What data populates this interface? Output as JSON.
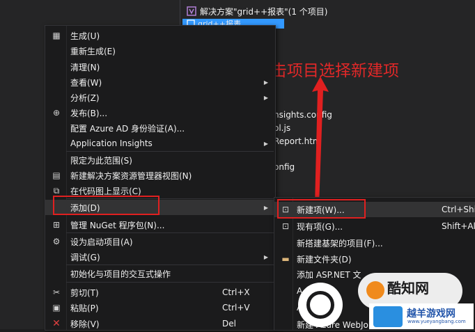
{
  "solution_explorer": {
    "solution_label": "解决方案\"grid++报表\"(1 个项目)",
    "project_label": "grid++报表",
    "files": [
      "nsights.config",
      "ol.js",
      "Report.htm",
      "onfig"
    ]
  },
  "annotation": "右键单击项目选择新建项",
  "context_menu": {
    "build": "生成(U)",
    "rebuild": "重新生成(E)",
    "clean": "清理(N)",
    "view": "查看(W)",
    "analyze": "分析(Z)",
    "publish": "发布(B)...",
    "azure_ad": "配置 Azure AD 身份验证(A)...",
    "app_insights": "Application Insights",
    "scope": "限定为此范围(S)",
    "new_view": "新建解决方案资源管理器视图(N)",
    "code_map": "在代码图上显示(C)",
    "add": "添加(D)",
    "nuget": "管理 NuGet 程序包(N)...",
    "startup": "设为启动项目(A)",
    "debug": "调试(G)",
    "interactive": "初始化与项目的交互式操作",
    "cut": "剪切(T)",
    "cut_sc": "Ctrl+X",
    "paste": "粘贴(P)",
    "paste_sc": "Ctrl+V",
    "remove": "移除(V)",
    "remove_sc": "Del"
  },
  "add_submenu": {
    "new_item": "新建项(W)...",
    "new_item_sc": "Ctrl+Shift",
    "existing_item": "现有项(G)...",
    "existing_item_sc": "Shift+Alt",
    "scaffolded": "新搭建基架的项目(F)...",
    "new_folder": "新建文件夹(D)",
    "asp_net": "添加 ASP.NET 文",
    "row6": "A",
    "row7": "A",
    "azure_webjob": "新建 Azure WebJob"
  },
  "watermark": {
    "brand": "酷知网",
    "site": "越羊游戏网",
    "url": "www.yueyangbang.com"
  }
}
